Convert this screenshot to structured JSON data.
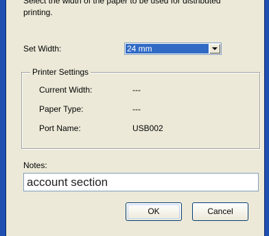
{
  "description": {
    "line1": "Select the width of the paper to be used for distributed",
    "line2": "printing."
  },
  "set_width": {
    "label": "Set Width:",
    "selected": "24 mm"
  },
  "printer_settings": {
    "title": "Printer Settings",
    "current_width_label": "Current Width:",
    "current_width_value": "---",
    "paper_type_label": "Paper Type:",
    "paper_type_value": "---",
    "port_name_label": "Port Name:",
    "port_name_value": "USB002"
  },
  "notes": {
    "label": "Notes:",
    "value": "account section"
  },
  "buttons": {
    "ok": "OK",
    "cancel": "Cancel"
  },
  "colors": {
    "titlebar": "#1f4fb0",
    "dialog_bg": "#ece9d8",
    "selection": "#316ac5"
  }
}
